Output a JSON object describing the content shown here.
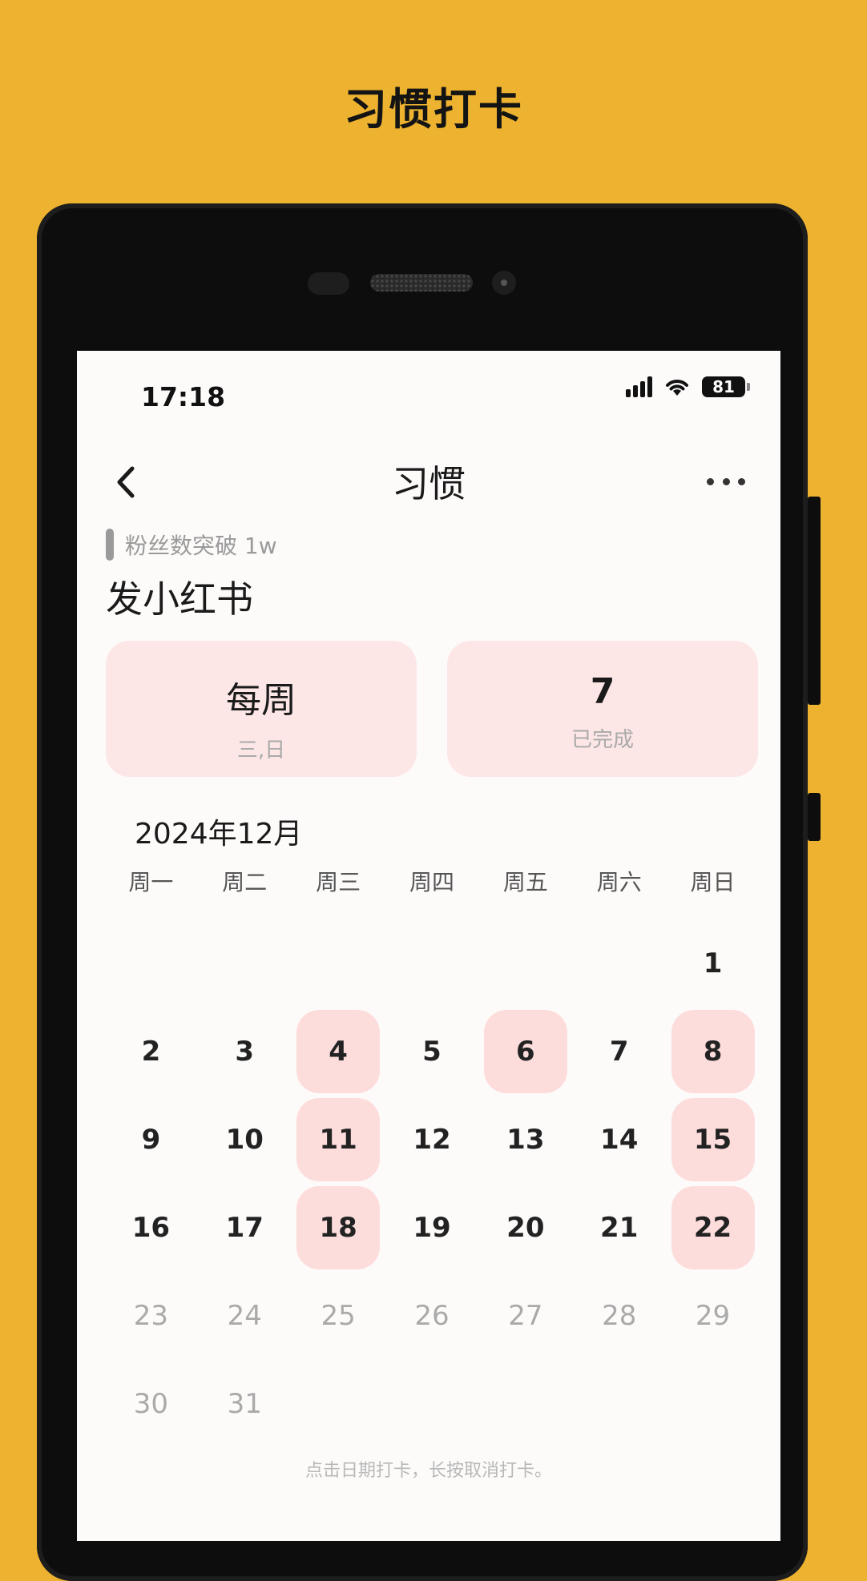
{
  "promo": {
    "title": "习惯打卡"
  },
  "status_bar": {
    "time": "17:18",
    "battery": "81"
  },
  "nav": {
    "title": "习惯"
  },
  "habit": {
    "goal": "粉丝数突破 1w",
    "name": "发小红书"
  },
  "cards": {
    "frequency": {
      "value": "每周",
      "days": "三,日"
    },
    "completed": {
      "value": "7",
      "label": "已完成"
    }
  },
  "calendar": {
    "month": "2024年12月",
    "weekdays": [
      "周一",
      "周二",
      "周三",
      "周四",
      "周五",
      "周六",
      "周日"
    ],
    "leading_blank_days": 6,
    "today": 22,
    "days": [
      "1",
      "2",
      "3",
      "4",
      "5",
      "6",
      "7",
      "8",
      "9",
      "10",
      "11",
      "12",
      "13",
      "14",
      "15",
      "16",
      "17",
      "18",
      "19",
      "20",
      "21",
      "22",
      "23",
      "24",
      "25",
      "26",
      "27",
      "28",
      "29",
      "30",
      "31"
    ],
    "checked": [
      4,
      6,
      8,
      11,
      15,
      18,
      22
    ]
  },
  "hint": "点击日期打卡，长按取消打卡。",
  "colors": {
    "background": "#EDB22F",
    "checked": "#FDDDDC",
    "card": "#FDE6E6"
  }
}
